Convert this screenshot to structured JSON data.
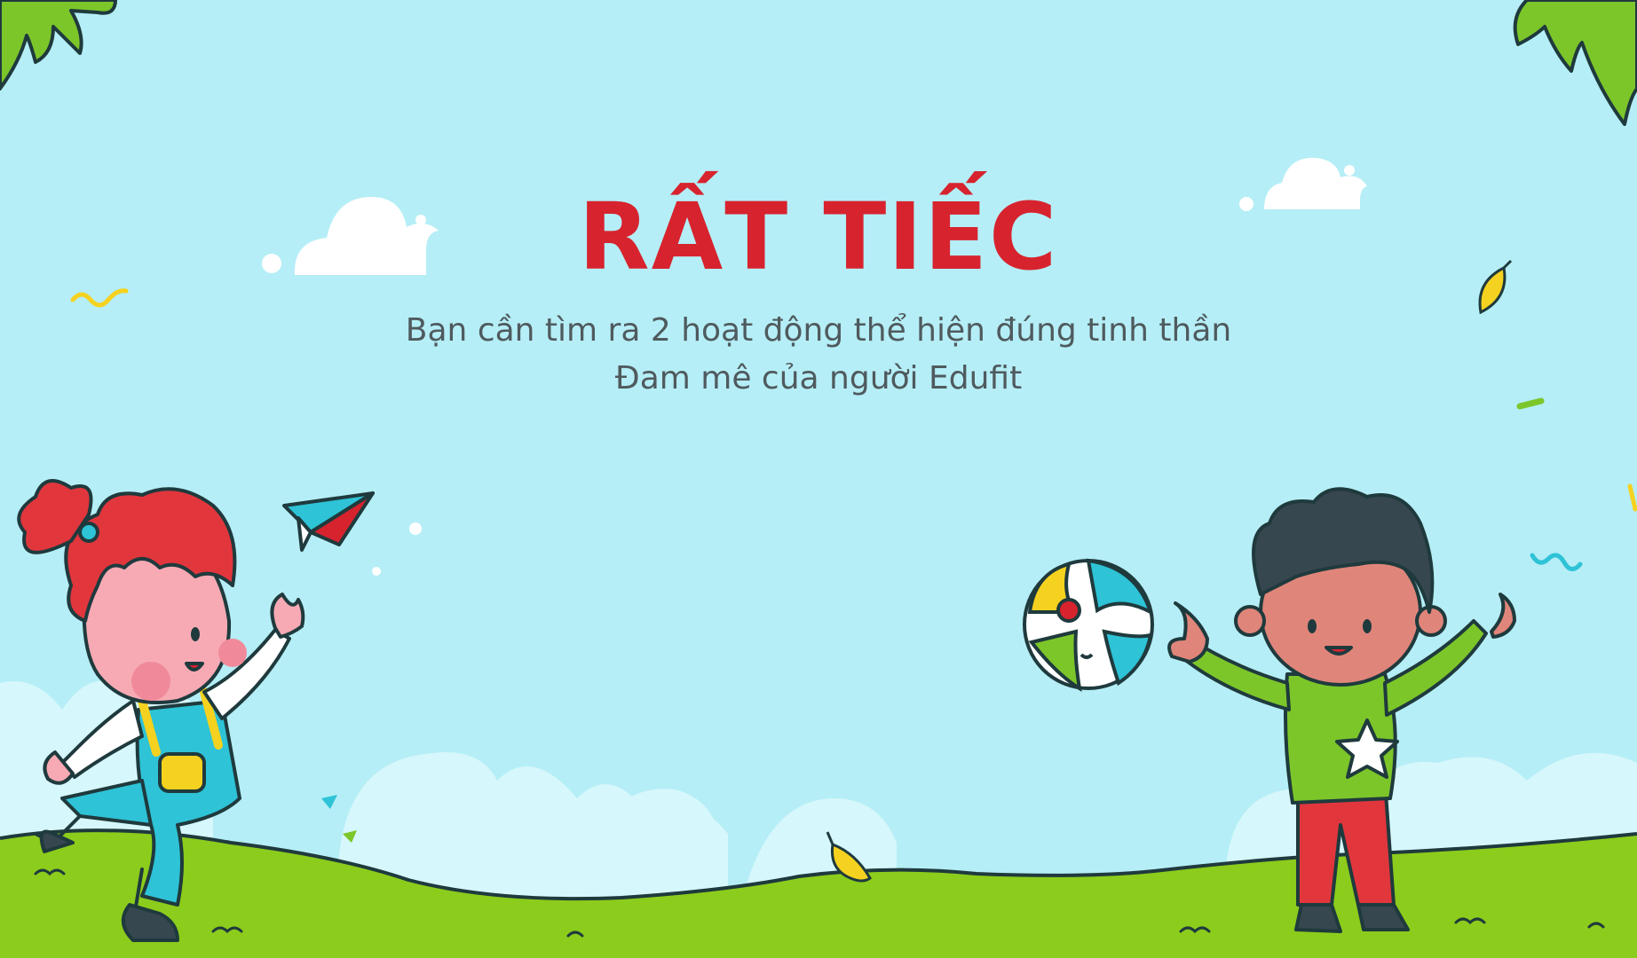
{
  "content": {
    "title": "RẤT TIẾC",
    "subtitle_line1": "Bạn cần tìm ra 2 hoạt động thể hiện đúng tinh thần",
    "subtitle_line2": "Đam mê của người Edufit"
  },
  "colors": {
    "sky": "#b5eef6",
    "title": "#d7232e",
    "subtitle": "#4f5a5e",
    "grass": "#8ccc1c",
    "leaves": "#7cc62a",
    "outline": "#1f3a3d"
  },
  "illustrations": {
    "left": "girl-throwing-paper-plane",
    "right": "boy-catching-beach-ball"
  }
}
